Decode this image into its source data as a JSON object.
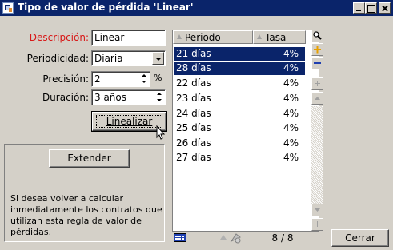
{
  "window": {
    "title": "Tipo de valor de pérdida 'Linear'"
  },
  "form": {
    "descripcion": {
      "label": "Descripción:",
      "value": "Linear",
      "label_color": "#d81818"
    },
    "periodicidad": {
      "label": "Periodicidad:",
      "value": "Diaria"
    },
    "precision": {
      "label": "Precisión:",
      "value": "2",
      "unit": "%"
    },
    "duracion": {
      "label": "Duración:",
      "value": "3 años"
    },
    "linealizar_label": "Linealizar"
  },
  "group": {
    "extender_label": "Extender",
    "description": "Si desea volver a calcular inmediatamente los contratos que utilizan esta regla de valor de pérdidas."
  },
  "list": {
    "columns": [
      "Periodo",
      "Tasa"
    ],
    "rows": [
      {
        "periodo": "21 días",
        "tasa": "4%",
        "selected": true
      },
      {
        "periodo": "28 días",
        "tasa": "4%",
        "selected": true
      },
      {
        "periodo": "22 días",
        "tasa": "4%",
        "selected": false
      },
      {
        "periodo": "23 días",
        "tasa": "4%",
        "selected": false
      },
      {
        "periodo": "24 días",
        "tasa": "4%",
        "selected": false
      },
      {
        "periodo": "25 días",
        "tasa": "4%",
        "selected": false
      },
      {
        "periodo": "26 días",
        "tasa": "4%",
        "selected": false
      },
      {
        "periodo": "27 días",
        "tasa": "4%",
        "selected": false
      }
    ],
    "record_count": "8 / 8"
  },
  "actions": {
    "cerrar_label": "Cerrar"
  },
  "colors": {
    "titlebar": "#0a246a",
    "selection": "#0a246a",
    "required_label": "#d81818"
  },
  "icons": [
    "window-icon",
    "minimize-icon",
    "maximize-icon",
    "close-icon",
    "search-icon",
    "add-icon",
    "remove-icon",
    "chevron-down-icon",
    "spin-up-icon",
    "spin-down-icon",
    "grid-icon",
    "filter-icon",
    "mouse-cursor-icon"
  ]
}
